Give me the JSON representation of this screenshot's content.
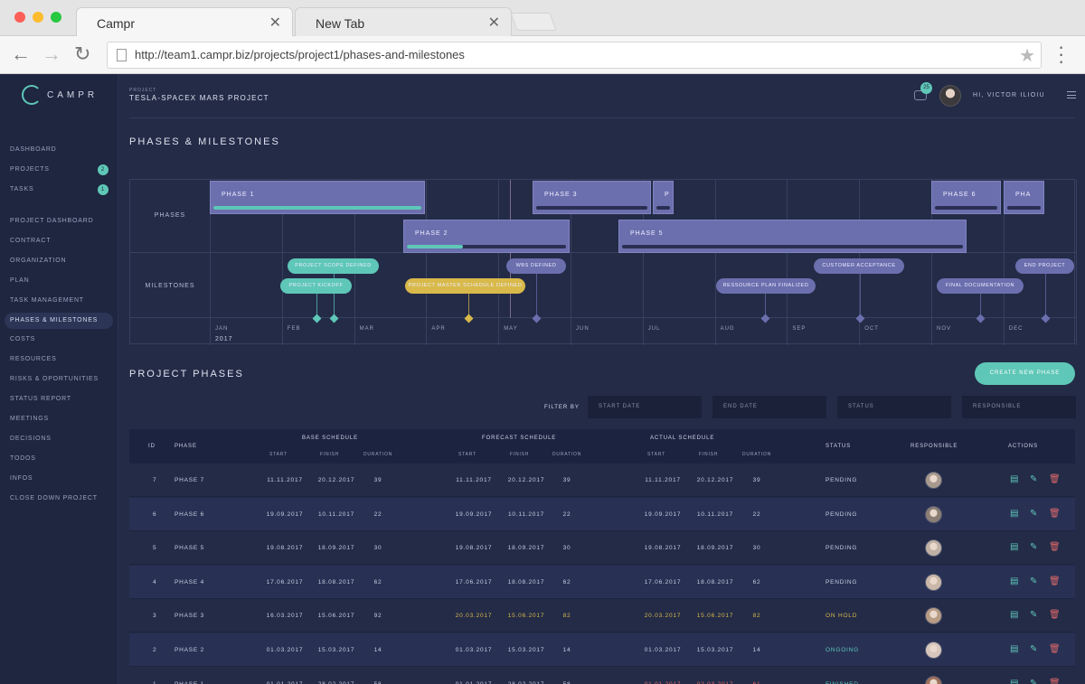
{
  "browser": {
    "tabs": [
      {
        "title": "Campr"
      },
      {
        "title": "New Tab"
      }
    ],
    "url": "http://team1.campr.biz/projects/project1/phases-and-milestones"
  },
  "logo": {
    "text": "CAMPR"
  },
  "sidebar": {
    "top_items": [
      {
        "label": "DASHBOARD"
      },
      {
        "label": "PROJECTS",
        "badge": "2"
      },
      {
        "label": "TASKS",
        "badge": "1"
      }
    ],
    "project_items": [
      {
        "label": "PROJECT DASHBOARD"
      },
      {
        "label": "CONTRACT"
      },
      {
        "label": "ORGANIZATION"
      },
      {
        "label": "PLAN"
      },
      {
        "label": "TASK MANAGEMENT"
      },
      {
        "label": "PHASES & MILESTONES",
        "active": true
      },
      {
        "label": "COSTS"
      },
      {
        "label": "RESOURCES"
      },
      {
        "label": "RISKS & OPORTUNITIES"
      },
      {
        "label": "STATUS REPORT"
      },
      {
        "label": "MEETINGS"
      },
      {
        "label": "DECISIONS"
      },
      {
        "label": "TODOS"
      },
      {
        "label": "INFOS"
      },
      {
        "label": "CLOSE DOWN PROJECT"
      }
    ]
  },
  "header": {
    "project_label": "PROJECT",
    "project_name": "TESLA-SPACEX MARS PROJECT",
    "notifications": "25",
    "greeting": "HI, VICTOR ILIOIU"
  },
  "gantt": {
    "title": "PHASES & MILESTONES",
    "row_labels": {
      "phases": "PHASES",
      "milestones": "MILESTONES"
    },
    "year": "2017",
    "months": [
      "JAN",
      "FEB",
      "MAR",
      "APR",
      "MAY",
      "JUN",
      "JUL",
      "AUG",
      "SEP",
      "OCT",
      "NOV",
      "DEC"
    ],
    "phases": [
      {
        "label": "PHASE 1",
        "progress": 1.0
      },
      {
        "label": "PHASE 2",
        "progress": 0.35
      },
      {
        "label": "PHASE 3",
        "progress": 0
      },
      {
        "label": "P",
        "progress": 0
      },
      {
        "label": "PHASE 5",
        "progress": 0
      },
      {
        "label": "PHASE 6",
        "progress": 0
      },
      {
        "label": "PHA",
        "progress": 0
      }
    ],
    "milestones": [
      {
        "label": "PROJECT SCOPE DEFINED",
        "status": "done"
      },
      {
        "label": "PROJECT KICKOFF",
        "status": "done"
      },
      {
        "label": "PROJECT MASTER SCHEDULE DEFINED",
        "status": "warning"
      },
      {
        "label": "WBS DEFINED",
        "status": "pending"
      },
      {
        "label": "RESSOURCE PLAN FINALIZED",
        "status": "pending"
      },
      {
        "label": "CUSTOMER ACCEPTANCE",
        "status": "pending"
      },
      {
        "label": "FINAL DOCUMENTATION",
        "status": "pending"
      },
      {
        "label": "END PROJECT",
        "status": "pending"
      }
    ]
  },
  "phases_table": {
    "title": "PROJECT PHASES",
    "create_label": "CREATE NEW PHASE",
    "filter_label": "FILTER BY",
    "filters": [
      "START DATE",
      "END DATE",
      "STATUS",
      "RESPONSIBLE"
    ],
    "headers": {
      "id": "ID",
      "phase": "PHASE",
      "base": "BASE SCHEDULE",
      "forecast": "FORECAST SCHEDULE",
      "actual": "ACTUAL SCHEDULE",
      "start": "START",
      "finish": "FINISH",
      "duration": "DURATION",
      "status": "STATUS",
      "responsible": "RESPONSIBLE",
      "actions": "ACTIONS"
    },
    "rows": [
      {
        "id": "7",
        "phase": "PHASE 7",
        "b_start": "11.11.2017",
        "b_finish": "20.12.2017",
        "b_dur": "39",
        "f_start": "11.11.2017",
        "f_finish": "20.12.2017",
        "f_dur": "39",
        "a_start": "11.11.2017",
        "a_finish": "20.12.2017",
        "a_dur": "39",
        "status": "PENDING"
      },
      {
        "id": "6",
        "phase": "PHASE 6",
        "b_start": "19.09.2017",
        "b_finish": "10.11.2017",
        "b_dur": "22",
        "f_start": "19.09.2017",
        "f_finish": "10.11.2017",
        "f_dur": "22",
        "a_start": "19.09.2017",
        "a_finish": "10.11.2017",
        "a_dur": "22",
        "status": "PENDING"
      },
      {
        "id": "5",
        "phase": "PHASE 5",
        "b_start": "19.08.2017",
        "b_finish": "18.09.2017",
        "b_dur": "30",
        "f_start": "19.08.2017",
        "f_finish": "18.09.2017",
        "f_dur": "30",
        "a_start": "19.08.2017",
        "a_finish": "18.09.2017",
        "a_dur": "30",
        "status": "PENDING"
      },
      {
        "id": "4",
        "phase": "PHASE 4",
        "b_start": "17.06.2017",
        "b_finish": "18.08.2017",
        "b_dur": "62",
        "f_start": "17.06.2017",
        "f_finish": "18.08.2017",
        "f_dur": "62",
        "a_start": "17.06.2017",
        "a_finish": "18.08.2017",
        "a_dur": "62",
        "status": "PENDING"
      },
      {
        "id": "3",
        "phase": "PHASE 3",
        "b_start": "16.03.2017",
        "b_finish": "15.06.2017",
        "b_dur": "92",
        "f_start": "20.03.2017",
        "f_finish": "15.06.2017",
        "f_dur": "82",
        "a_start": "20.03.2017",
        "a_finish": "15.06.2017",
        "a_dur": "82",
        "status": "ON HOLD"
      },
      {
        "id": "2",
        "phase": "PHASE 2",
        "b_start": "01.03.2017",
        "b_finish": "15.03.2017",
        "b_dur": "14",
        "f_start": "01.03.2017",
        "f_finish": "15.03.2017",
        "f_dur": "14",
        "a_start": "01.03.2017",
        "a_finish": "15.03.2017",
        "a_dur": "14",
        "status": "ONGOING"
      },
      {
        "id": "1",
        "phase": "PHASE 1",
        "b_start": "01.01.2017",
        "b_finish": "28.02.2017",
        "b_dur": "58",
        "f_start": "01.01.2017",
        "f_finish": "28.02.2017",
        "f_dur": "58",
        "a_start": "01.01.2017",
        "a_finish": "02.03.2017",
        "a_dur": "61",
        "status": "FINISHED"
      }
    ]
  },
  "colors": {
    "accent": "#5fc7b8",
    "warning": "#d8b94a",
    "danger": "#e06a6a",
    "phase_bar": "#6b6fae",
    "milestone_pending": "#6b6fae"
  }
}
